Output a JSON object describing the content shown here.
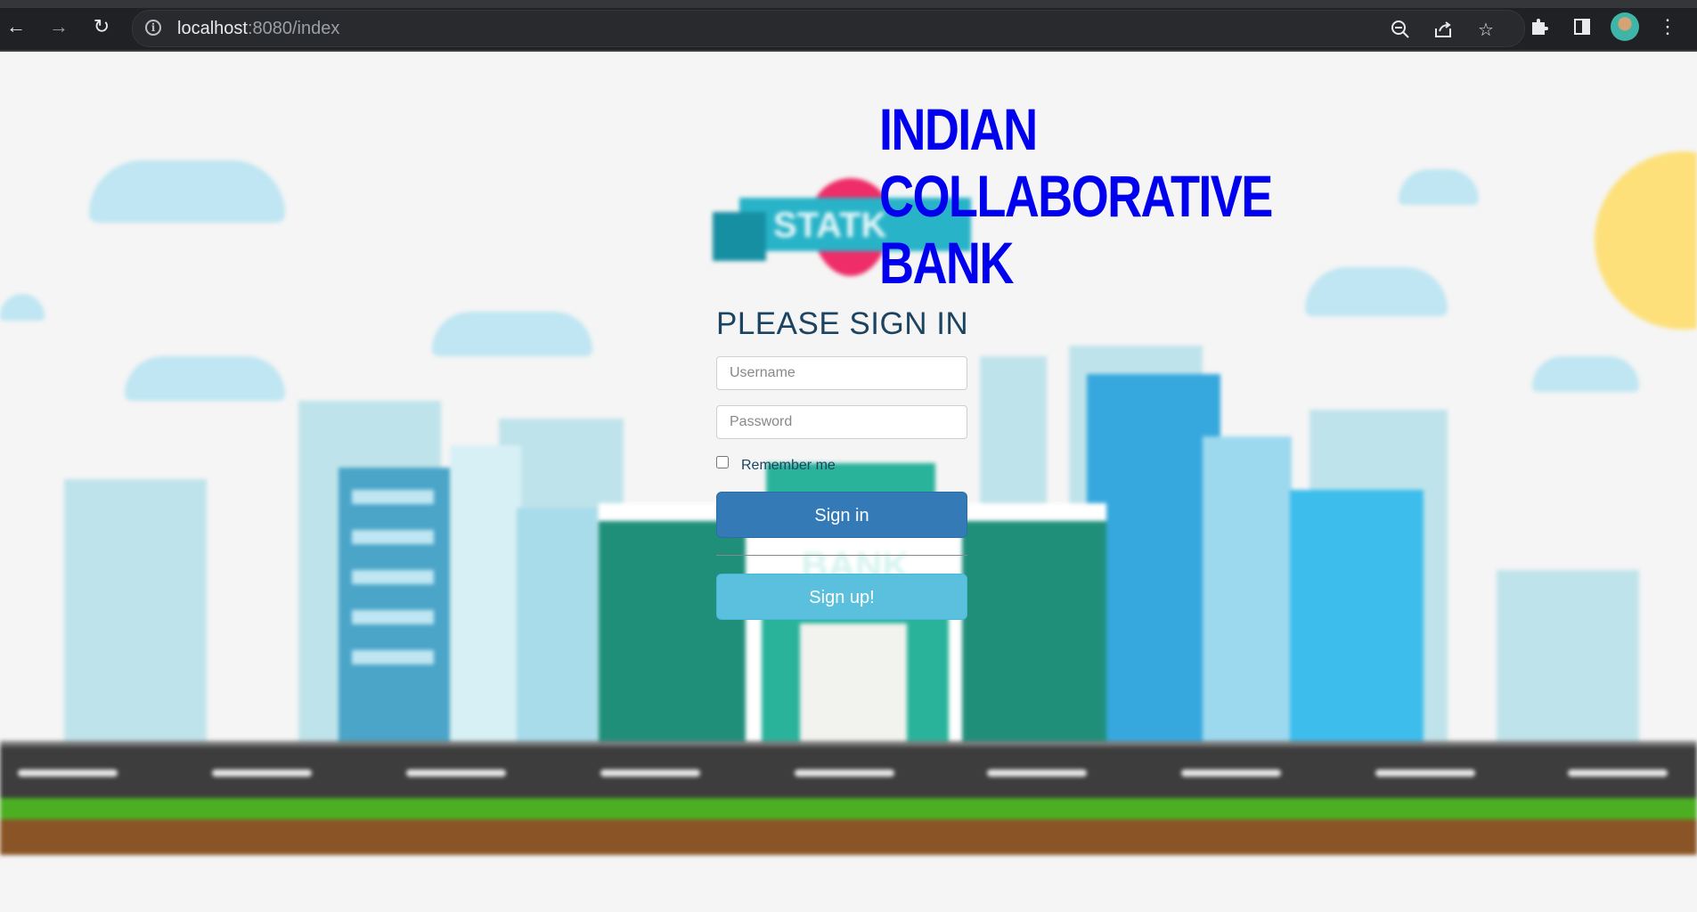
{
  "browser": {
    "url_host": "localhost",
    "url_path": ":8080/index",
    "icons": {
      "back": "arrow-left-icon",
      "forward": "arrow-right-icon",
      "reload": "reload-icon",
      "site_info": "info-icon",
      "zoom": "zoom-out-icon",
      "share": "share-icon",
      "bookmark": "star-icon",
      "extensions": "puzzle-icon",
      "side_panel": "side-panel-icon",
      "menu": "kebab-menu-icon"
    }
  },
  "page": {
    "title": "INDIAN COLLABORATIVE BANK",
    "background_sign_text": "STATK",
    "background_bank_text": "BANK",
    "form": {
      "heading": "PLEASE SIGN IN",
      "username_placeholder": "Username",
      "password_placeholder": "Password",
      "remember_label": "Remember me",
      "signin_label": "Sign in",
      "signup_label": "Sign up!"
    },
    "colors": {
      "title": "#0000ee",
      "heading": "#1c4461",
      "signin_button": "#337ab7",
      "signup_button": "#5bc0de"
    }
  }
}
